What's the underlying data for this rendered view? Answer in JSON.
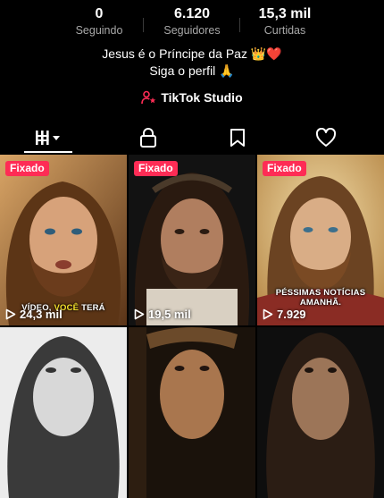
{
  "stats": [
    {
      "value": "0",
      "label": "Seguindo"
    },
    {
      "value": "6.120",
      "label": "Seguidores"
    },
    {
      "value": "15,3 mil",
      "label": "Curtidas"
    }
  ],
  "bio": {
    "line1": "Jesus é o Príncipe da Paz 👑❤️",
    "line2": "Siga o perfil 🙏"
  },
  "studio_link": {
    "label": "TikTok Studio",
    "icon": "person-star-icon"
  },
  "tabs": [
    {
      "icon": "grid-icon",
      "active": true
    },
    {
      "icon": "lock-icon"
    },
    {
      "icon": "bookmark-icon"
    },
    {
      "icon": "heart-icon"
    }
  ],
  "videos": [
    {
      "pinned_label": "Fixado",
      "views": "24,3 mil",
      "caption_a": "VÍDEO, ",
      "caption_b": "VOCÊ",
      "caption_c": " TERÁ"
    },
    {
      "pinned_label": "Fixado",
      "views": "19,5 mil"
    },
    {
      "pinned_label": "Fixado",
      "views": "7.929",
      "caption_a": "PÉSSIMAS NOTÍCIAS AMANHÃ."
    },
    {},
    {},
    {}
  ],
  "colors": {
    "accent": "#fe2c55",
    "highlight": "#f5e12a",
    "background": "#000000",
    "muted": "#a8a8a8"
  }
}
